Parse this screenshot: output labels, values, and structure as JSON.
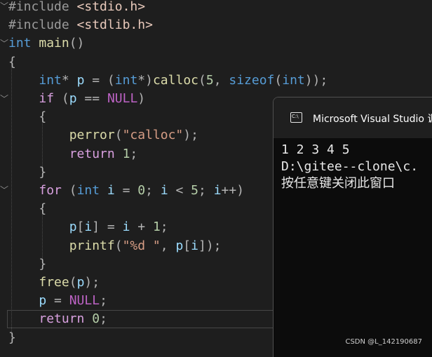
{
  "editor": {
    "lines": [
      [
        [
          "#include",
          "pp"
        ],
        [
          " ",
          "txt"
        ],
        [
          "<stdio.h>",
          "inc"
        ]
      ],
      [
        [
          "#include",
          "pp"
        ],
        [
          " ",
          "txt"
        ],
        [
          "<stdlib.h>",
          "inc"
        ]
      ],
      [
        [
          "int",
          "kw"
        ],
        [
          " ",
          "txt"
        ],
        [
          "main",
          "fn"
        ],
        [
          "()",
          "op"
        ]
      ],
      [
        [
          "{",
          "op"
        ]
      ],
      [
        [
          "    ",
          "txt"
        ],
        [
          "int",
          "kw"
        ],
        [
          "*",
          "op"
        ],
        [
          " ",
          "txt"
        ],
        [
          "p",
          "var"
        ],
        [
          " = (",
          "op"
        ],
        [
          "int",
          "kw"
        ],
        [
          "*)",
          "op"
        ],
        [
          "calloc",
          "fn"
        ],
        [
          "(",
          "op"
        ],
        [
          "5",
          "num"
        ],
        [
          ", ",
          "op"
        ],
        [
          "sizeof",
          "kw"
        ],
        [
          "(",
          "op"
        ],
        [
          "int",
          "kw"
        ],
        [
          "));",
          "op"
        ]
      ],
      [
        [
          "    ",
          "txt"
        ],
        [
          "if",
          "ctl"
        ],
        [
          " (",
          "op"
        ],
        [
          "p",
          "var"
        ],
        [
          " == ",
          "op"
        ],
        [
          "NULL",
          "macro"
        ],
        [
          ")",
          "op"
        ]
      ],
      [
        [
          "    ",
          "txt"
        ],
        [
          "{",
          "op"
        ]
      ],
      [
        [
          "        ",
          "txt"
        ],
        [
          "perror",
          "fn"
        ],
        [
          "(",
          "op"
        ],
        [
          "\"calloc\"",
          "str"
        ],
        [
          ");",
          "op"
        ]
      ],
      [
        [
          "        ",
          "txt"
        ],
        [
          "return",
          "ctl"
        ],
        [
          " ",
          "txt"
        ],
        [
          "1",
          "num"
        ],
        [
          ";",
          "op"
        ]
      ],
      [
        [
          "    ",
          "txt"
        ],
        [
          "}",
          "op"
        ]
      ],
      [
        [
          "    ",
          "txt"
        ],
        [
          "for",
          "ctl"
        ],
        [
          " (",
          "op"
        ],
        [
          "int",
          "kw"
        ],
        [
          " ",
          "txt"
        ],
        [
          "i",
          "var"
        ],
        [
          " = ",
          "op"
        ],
        [
          "0",
          "num"
        ],
        [
          "; ",
          "op"
        ],
        [
          "i",
          "var"
        ],
        [
          " < ",
          "op"
        ],
        [
          "5",
          "num"
        ],
        [
          "; ",
          "op"
        ],
        [
          "i",
          "var"
        ],
        [
          "++)",
          "op"
        ]
      ],
      [
        [
          "    ",
          "txt"
        ],
        [
          "{",
          "op"
        ]
      ],
      [
        [
          "        ",
          "txt"
        ],
        [
          "p",
          "var"
        ],
        [
          "[",
          "op"
        ],
        [
          "i",
          "var"
        ],
        [
          "] = ",
          "op"
        ],
        [
          "i",
          "var"
        ],
        [
          " + ",
          "op"
        ],
        [
          "1",
          "num"
        ],
        [
          ";",
          "op"
        ]
      ],
      [
        [
          "        ",
          "txt"
        ],
        [
          "printf",
          "fn"
        ],
        [
          "(",
          "op"
        ],
        [
          "\"%d \"",
          "str"
        ],
        [
          ", ",
          "op"
        ],
        [
          "p",
          "var"
        ],
        [
          "[",
          "op"
        ],
        [
          "i",
          "var"
        ],
        [
          "]);",
          "op"
        ]
      ],
      [
        [
          "    ",
          "txt"
        ],
        [
          "}",
          "op"
        ]
      ],
      [
        [
          "    ",
          "txt"
        ],
        [
          "free",
          "fn"
        ],
        [
          "(",
          "op"
        ],
        [
          "p",
          "var"
        ],
        [
          ");",
          "op"
        ]
      ],
      [
        [
          "    ",
          "txt"
        ],
        [
          "p",
          "var"
        ],
        [
          " = ",
          "op"
        ],
        [
          "NULL",
          "macro"
        ],
        [
          ";",
          "op"
        ]
      ],
      [
        [
          "    ",
          "txt"
        ],
        [
          "return",
          "ctl"
        ],
        [
          " ",
          "txt"
        ],
        [
          "0",
          "num"
        ],
        [
          ";",
          "op"
        ]
      ],
      [
        [
          "}",
          "op"
        ]
      ]
    ],
    "fold_markers": [
      "﹀",
      "﹀",
      "﹀",
      "﹀"
    ]
  },
  "console": {
    "title": "Microsoft Visual Studio 调试控制台",
    "icon": "console-app-icon",
    "icon_text": "C:\\",
    "output": [
      "1 2 3 4 5",
      "D:\\gitee--clone\\c.",
      "按任意键关闭此窗口"
    ]
  },
  "watermark": "CSDN @L_142190687",
  "colors": {
    "keyword": "#569cd6",
    "function": "#dcdcaa",
    "variable": "#9cdcfe",
    "string": "#d69d85",
    "number": "#b5cea8",
    "macro": "#bd63c5",
    "control": "#d8a0df",
    "background": "#1e1e1e"
  }
}
